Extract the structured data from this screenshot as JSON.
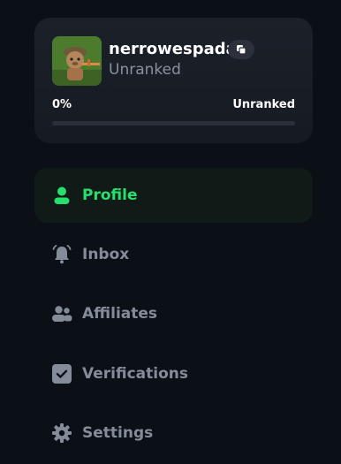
{
  "profile": {
    "username": "nerrowespada",
    "rank": "Unranked",
    "progress_percent_label": "0%",
    "progress_rank_label": "Unranked",
    "progress_fraction": 0
  },
  "nav": {
    "items": [
      {
        "label": "Profile",
        "icon": "user-icon",
        "active": true
      },
      {
        "label": "Inbox",
        "icon": "bell-icon",
        "active": false
      },
      {
        "label": "Affiliates",
        "icon": "users-icon",
        "active": false
      },
      {
        "label": "Verifications",
        "icon": "check-square-icon",
        "active": false
      },
      {
        "label": "Settings",
        "icon": "gear-icon",
        "active": false
      }
    ]
  },
  "colors": {
    "accent": "#25e06d",
    "muted": "#858c99",
    "background": "#0b0f16",
    "card": "#1a1e27"
  }
}
